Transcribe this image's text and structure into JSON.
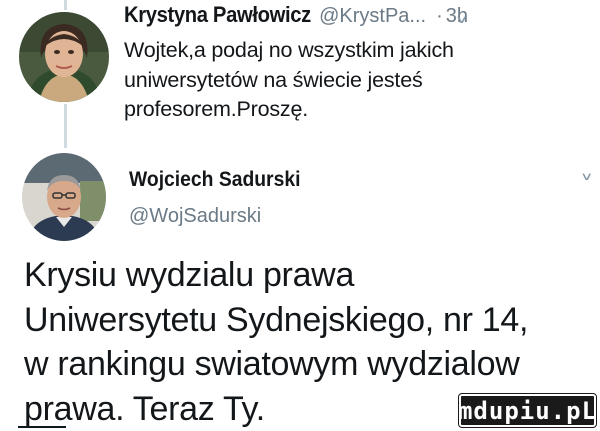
{
  "tweet1": {
    "name": "Krystyna Pawłowicz",
    "handle": "@KrystPa...",
    "separator": "·",
    "time": "3h",
    "text_lines": [
      "Wojtek,a podaj no wszystkim jakich",
      "uniwersytetów na świecie jesteś",
      "profesorem.Proszę."
    ]
  },
  "tweet2": {
    "name": "Wojciech Sadurski",
    "handle": "@WojSadurski",
    "text_lines": [
      "Krysiu wydzialu prawa",
      "Uniwersytetu Sydnejskiego, nr 14,",
      "w rankingu swiatowym wydzialow",
      "prawa. Teraz Ty."
    ]
  },
  "icons": {
    "menu_chevron": "chevron-down-icon"
  },
  "watermark": {
    "text": "mdupiu.pL"
  },
  "colors": {
    "text": "#14171a",
    "secondary_text": "#6b7a86",
    "thread_line": "#cfd9de",
    "watermark_bg": "#1a1a1a"
  }
}
